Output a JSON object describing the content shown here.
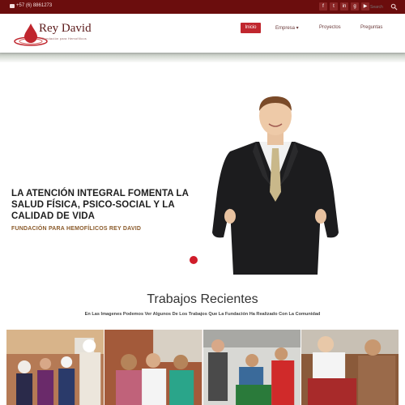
{
  "topbar": {
    "phone": "+57 (6) 8861273",
    "socials": [
      {
        "label": "f",
        "icon": "facebook-icon"
      },
      {
        "label": "t",
        "icon": "twitter-icon"
      },
      {
        "label": "in",
        "icon": "linkedin-icon"
      },
      {
        "label": "g",
        "icon": "google-plus-icon"
      },
      {
        "label": "▶",
        "icon": "youtube-icon"
      }
    ],
    "search_placeholder": "Search"
  },
  "header": {
    "logo_text": "Rey David",
    "logo_sub": "Fundación para Hemofílicos",
    "nav": [
      {
        "label": "Inicio",
        "active": true
      },
      {
        "label": "Empresa ▾",
        "active": false
      },
      {
        "label": "Proyectos",
        "active": false
      },
      {
        "label": "Preguntas",
        "active": false
      }
    ]
  },
  "hero": {
    "title": "LA ATENCIÓN INTEGRAL FOMENTA LA SALUD FÍSICA, PSICO-SOCIAL Y LA CALIDAD DE VIDA",
    "subtitle": "FUNDACIÓN PARA HEMOFÍLICOS REY DAVID"
  },
  "recent": {
    "title": "Trabajos Recientes",
    "subtitle": "En Las Imagenes Podemos Ver Algunos De Los Trabajos Que La Fundación Ha Realizado Con La Comunidad"
  },
  "colors": {
    "topbar": "#6b0d0d",
    "accent": "#c0262e",
    "brand_text": "#5b1a1a"
  }
}
